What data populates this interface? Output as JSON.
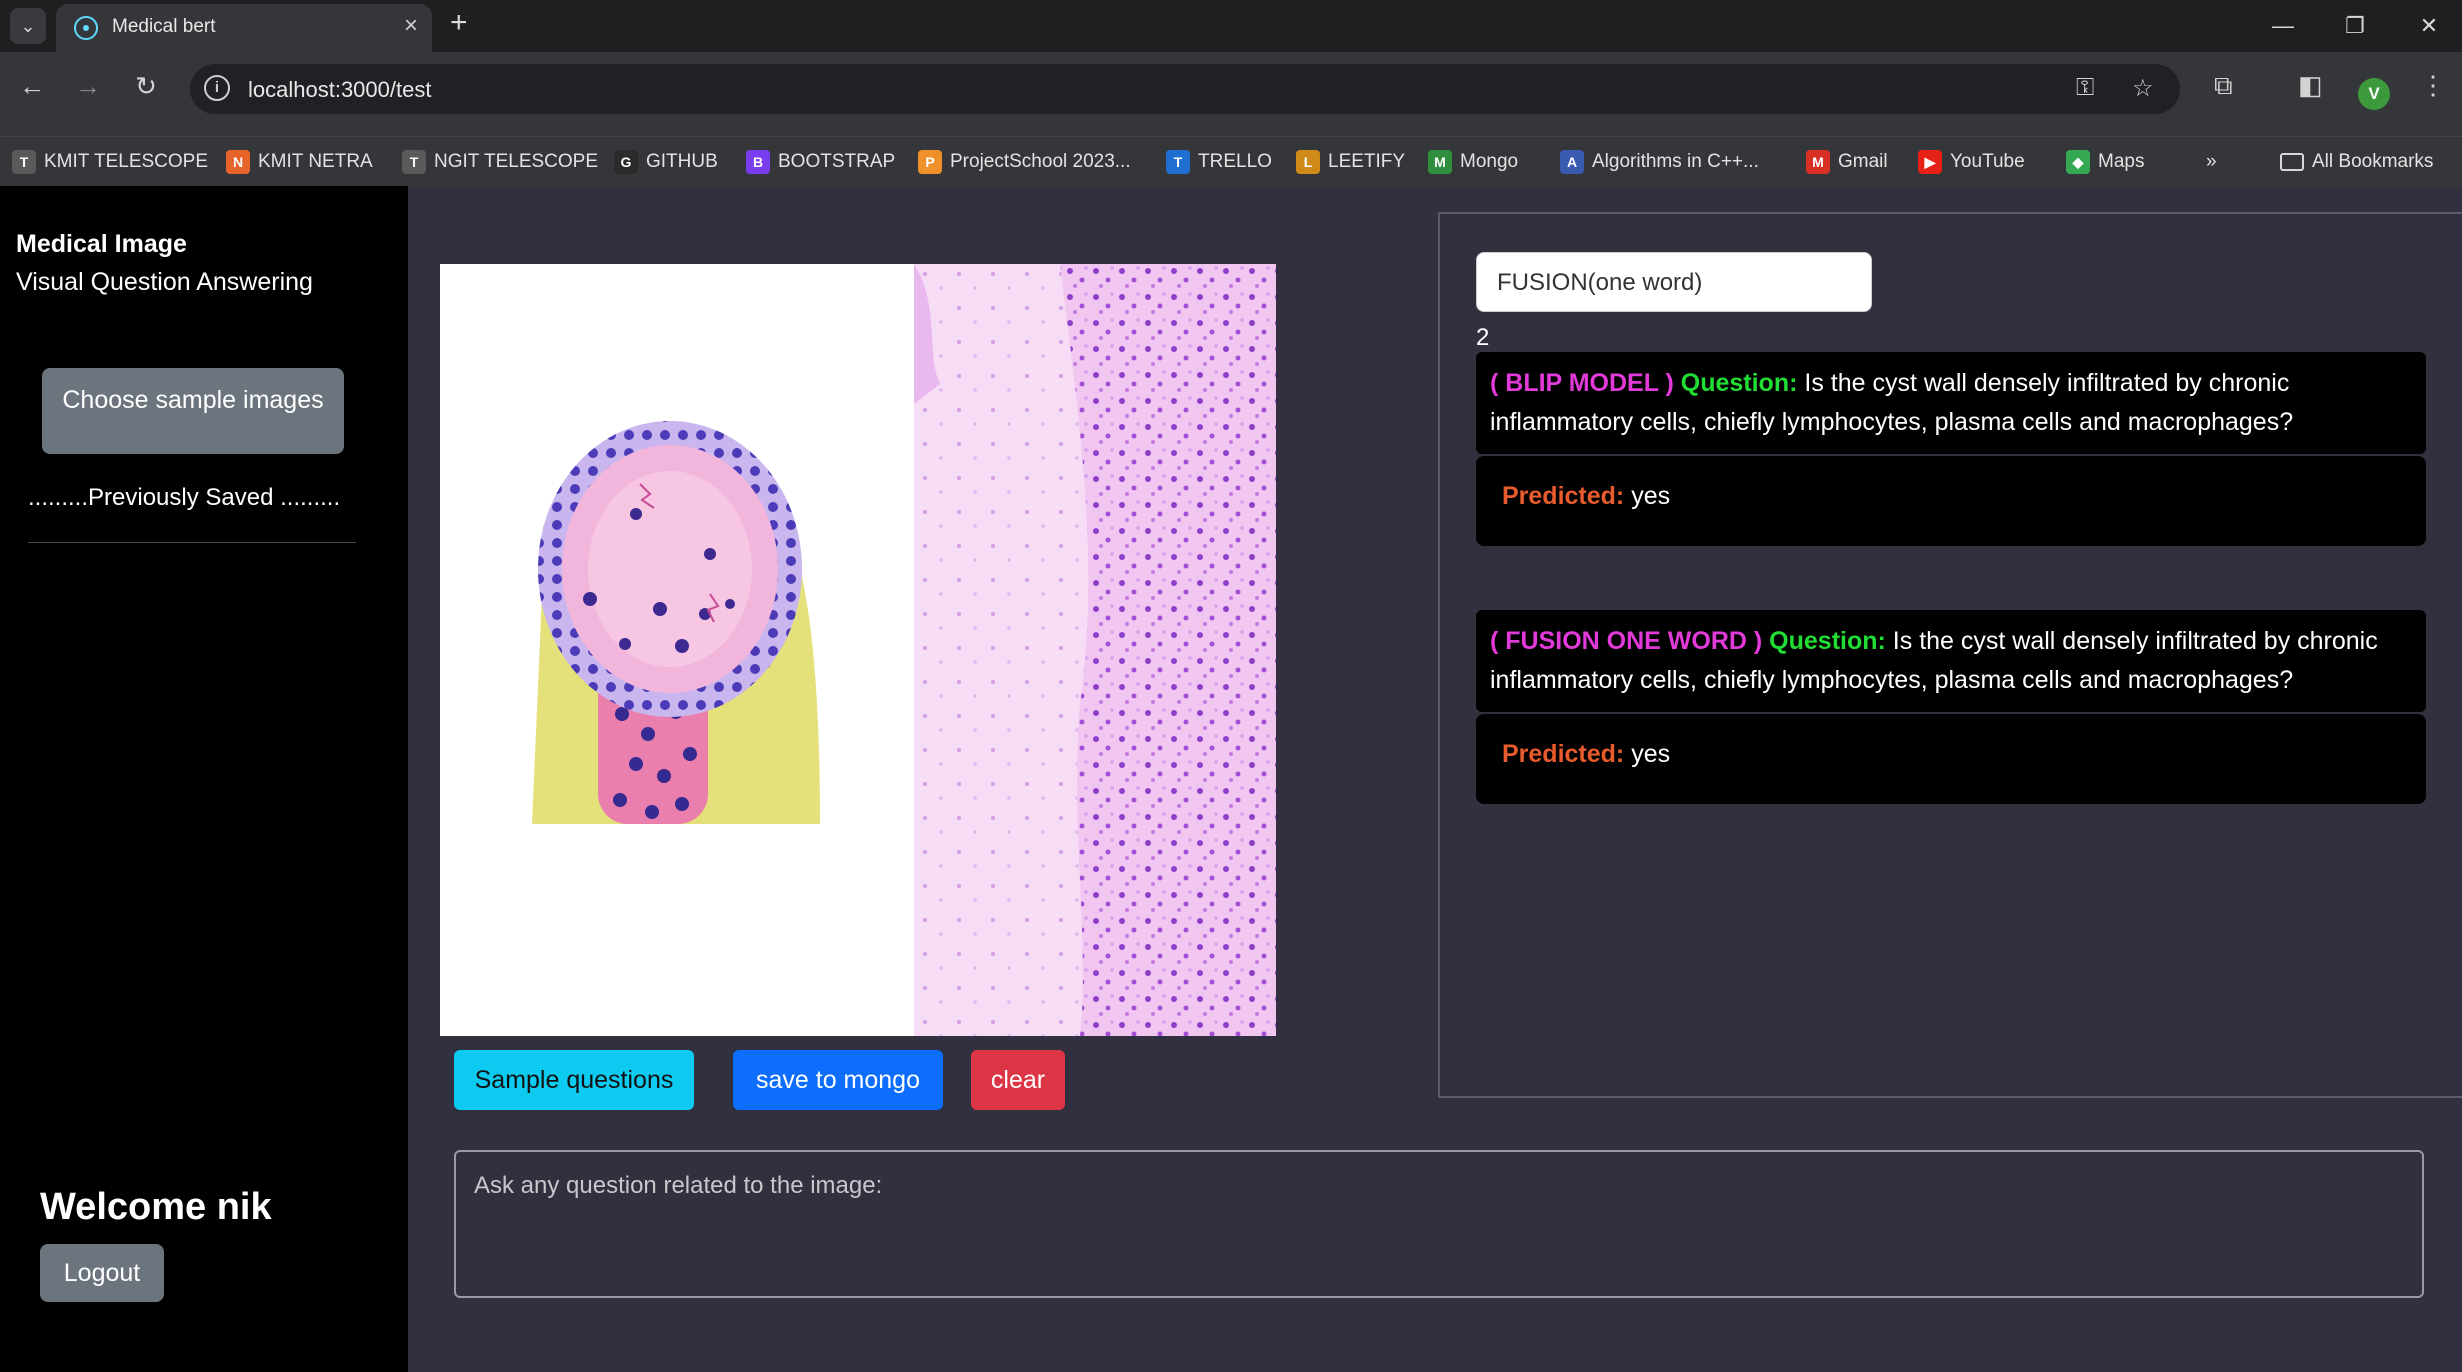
{
  "browser": {
    "tab_title": "Medical bert",
    "url": "localhost:3000/test",
    "profile_initial": "V",
    "bookmarks": [
      {
        "label": "KMIT TELESCOPE",
        "icon": "telescope-icon",
        "color": "#5a5a5a",
        "glyph": "T"
      },
      {
        "label": "KMIT NETRA",
        "icon": "netra-icon",
        "color": "#e8632b",
        "glyph": "N"
      },
      {
        "label": "NGIT TELESCOPE",
        "icon": "telescope-icon",
        "color": "#5a5a5a",
        "glyph": "T"
      },
      {
        "label": "GITHUB",
        "icon": "github-icon",
        "color": "#2b2b2b",
        "glyph": "G"
      },
      {
        "label": "BOOTSTRAP",
        "icon": "bootstrap-icon",
        "color": "#7a3cf0",
        "glyph": "B"
      },
      {
        "label": "ProjectSchool 2023...",
        "icon": "projectschool-icon",
        "color": "#f0902a",
        "glyph": "P"
      },
      {
        "label": "TRELLO",
        "icon": "trello-icon",
        "color": "#1f6fd0",
        "glyph": "T"
      },
      {
        "label": "LEETIFY",
        "icon": "leetify-icon",
        "color": "#d08a1a",
        "glyph": "L"
      },
      {
        "label": "Mongo",
        "icon": "mongo-leaf-icon",
        "color": "#2f8f3f",
        "glyph": "M"
      },
      {
        "label": "Algorithms in C++...",
        "icon": "gfg-icon",
        "color": "#3a5bb0",
        "glyph": "A"
      },
      {
        "label": "Gmail",
        "icon": "gmail-icon",
        "color": "#d93025",
        "glyph": "M"
      },
      {
        "label": "YouTube",
        "icon": "youtube-icon",
        "color": "#e62117",
        "glyph": "▶"
      },
      {
        "label": "Maps",
        "icon": "maps-icon",
        "color": "#34a853",
        "glyph": "◆"
      }
    ],
    "all_bookmarks_label": "All Bookmarks"
  },
  "sidebar": {
    "title": "Medical Image",
    "subtitle": "Visual Question Answering",
    "choose_button": "Choose sample images",
    "previously_saved": ".........Previously Saved .........",
    "welcome": "Welcome nik",
    "logout_button": "Logout"
  },
  "actions": {
    "sample_questions": "Sample questions",
    "save_to_mongo": "save to mongo",
    "clear": "clear"
  },
  "results": {
    "model_select_value": "FUSION(one word)",
    "count": "2",
    "items": [
      {
        "model": "( BLIP MODEL )",
        "question_label": "Question:",
        "question": "Is the cyst wall densely infiltrated by chronic inflammatory cells, chiefly lymphocytes, plasma cells and macrophages?",
        "predicted_label": "Predicted:",
        "answer": "yes"
      },
      {
        "model": "( FUSION ONE WORD )",
        "question_label": "Question:",
        "question": "Is the cyst wall densely infiltrated by chronic inflammatory cells, chiefly lymphocytes, plasma cells and macrophages?",
        "predicted_label": "Predicted:",
        "answer": "yes"
      }
    ]
  },
  "question_input": {
    "placeholder": "Ask any question related to the image:"
  },
  "colors": {
    "sidebar_bg": "#000000",
    "main_bg": "#30303f",
    "model_tag": "#e23ad9",
    "question_label": "#22dd33",
    "predicted_label": "#e75b2c",
    "btn_info": "#0dcaf0",
    "btn_primary": "#0d6efd",
    "btn_danger": "#dc3545",
    "btn_secondary": "#6c757d"
  }
}
